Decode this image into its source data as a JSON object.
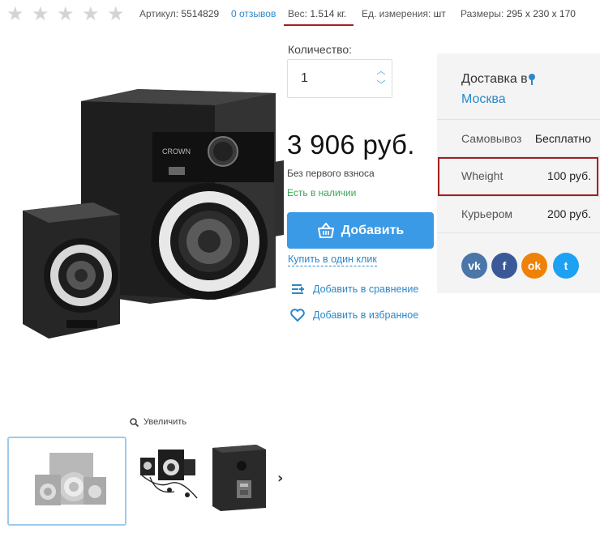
{
  "rating": {
    "stars": 5,
    "filled": 0
  },
  "meta": {
    "article_label": "Артикул:",
    "article_value": "5514829",
    "reviews_link": "0 отзывов",
    "weight_label": "Вес:",
    "weight_value": "1.514 кг.",
    "unit_label": "Ед. измерения:",
    "unit_value": "шт",
    "size_label": "Размеры:",
    "size_value": "295 x 230 x 170"
  },
  "product": {
    "brand_text": "CROWN",
    "quantity_label": "Количество:",
    "quantity_value": "1",
    "price": "3 906 руб.",
    "no_upfront": "Без первого взноса",
    "in_stock": "Есть в наличии",
    "add_button": "Добавить",
    "one_click": "Купить в один клик",
    "compare": "Добавить в сравнение",
    "favorite": "Добавить в избранное",
    "zoom": "Увеличить"
  },
  "delivery": {
    "title": "Доставка в",
    "city": "Москва",
    "rows": [
      {
        "label": "Самовывоз",
        "value": "Бесплатно"
      },
      {
        "label": "Wheight",
        "value": "100 руб."
      },
      {
        "label": "Курьером",
        "value": "200 руб."
      }
    ]
  },
  "social": {
    "vk": "vk",
    "fb": "f",
    "ok": "ok",
    "tw": "t"
  },
  "colors": {
    "accent": "#3a9ae6",
    "link": "#2b88c8",
    "stock": "#3aa655",
    "highlight": "#a31f24"
  }
}
